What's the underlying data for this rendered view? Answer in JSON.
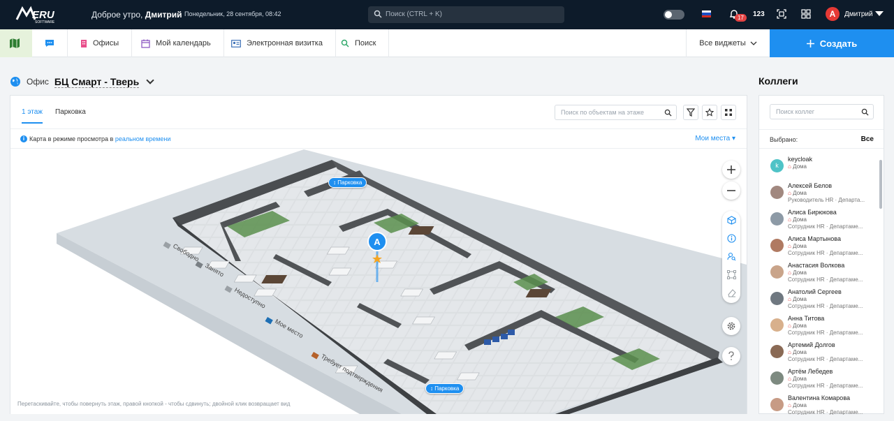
{
  "header": {
    "logo_text": "MERU",
    "logo_sub": "SOFTWARE",
    "greeting_prefix": "Доброе утро,",
    "greeting_name": "Дмитрий",
    "date": "Понедельник, 28 сентября, 08:42",
    "search_placeholder": "Поиск (CTRL + K)",
    "notifications_badge": "17",
    "counter": "123",
    "avatar_letter": "A",
    "user_name": "Дмитрий"
  },
  "nav": {
    "offices": "Офисы",
    "calendar": "Мой календарь",
    "card": "Электронная визитка",
    "search": "Поиск",
    "all_widgets": "Все виджеты",
    "create": "Создать"
  },
  "office": {
    "label": "Офис",
    "name": "БЦ Смарт - Тверь"
  },
  "floor_tabs": [
    {
      "label": "1 этаж",
      "active": true
    },
    {
      "label": "Парковка",
      "active": false
    }
  ],
  "floor_search_placeholder": "Поиск по объектам на этаже",
  "info": {
    "prefix": "Карта в режиме просмотра в",
    "link": "реальном времени",
    "my_places": "Мои места"
  },
  "map": {
    "parking_label_top": "Парковка",
    "parking_label_bottom": "Парковка",
    "legend": [
      "Свободно",
      "Занято",
      "Недоступно",
      "Мое место",
      "Требует подтверждения"
    ],
    "hint": "Перетаскивайте, чтобы повернуть этаж, правой кнопкой - чтобы сдвинуть; двойной клик возвращает вид"
  },
  "colleagues": {
    "title": "Коллеги",
    "search_placeholder": "Поиск коллег",
    "selected_label": "Выбрано:",
    "selected_value": "Все",
    "people": [
      {
        "name": "keycloak",
        "status": "Дома",
        "role": "",
        "color": "#4fc3c7",
        "initial": "k"
      },
      {
        "name": "Алексей Белов",
        "status": "Дома",
        "role": "Руководитель HR · Департа...",
        "color": "#a1887f",
        "initial": ""
      },
      {
        "name": "Алиса Бирюкова",
        "status": "Дома",
        "role": "Сотрудник HR · Департаме...",
        "color": "#8d9aa6",
        "initial": ""
      },
      {
        "name": "Алиса Мартынова",
        "status": "Дома",
        "role": "Сотрудник HR · Департаме...",
        "color": "#b07a62",
        "initial": ""
      },
      {
        "name": "Анастасия Волкова",
        "status": "Дома",
        "role": "Сотрудник HR · Департаме...",
        "color": "#c9a48a",
        "initial": ""
      },
      {
        "name": "Анатолий Сергеев",
        "status": "Дома",
        "role": "Сотрудник HR · Департаме...",
        "color": "#6f7880",
        "initial": ""
      },
      {
        "name": "Анна Титова",
        "status": "Дома",
        "role": "Сотрудник HR · Департаме...",
        "color": "#d8b08c",
        "initial": ""
      },
      {
        "name": "Артемий Долгов",
        "status": "Дома",
        "role": "Сотрудник HR · Департаме...",
        "color": "#8a6a55",
        "initial": ""
      },
      {
        "name": "Артём Лебедев",
        "status": "Дома",
        "role": "Сотрудник HR · Департаме...",
        "color": "#7d8a80",
        "initial": ""
      },
      {
        "name": "Валентина Комарова",
        "status": "Дома",
        "role": "Сотрудник HR · Департаме...",
        "color": "#c79b85",
        "initial": ""
      }
    ]
  }
}
